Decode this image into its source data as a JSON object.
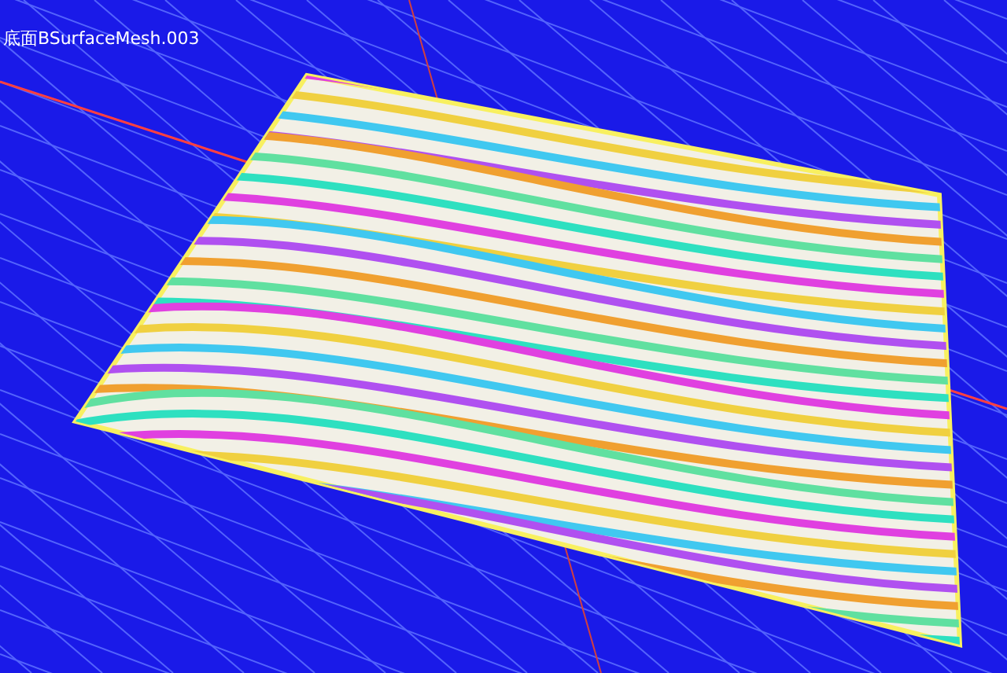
{
  "viewport": {
    "object_label": "底面BSurfaceMesh.003"
  }
}
